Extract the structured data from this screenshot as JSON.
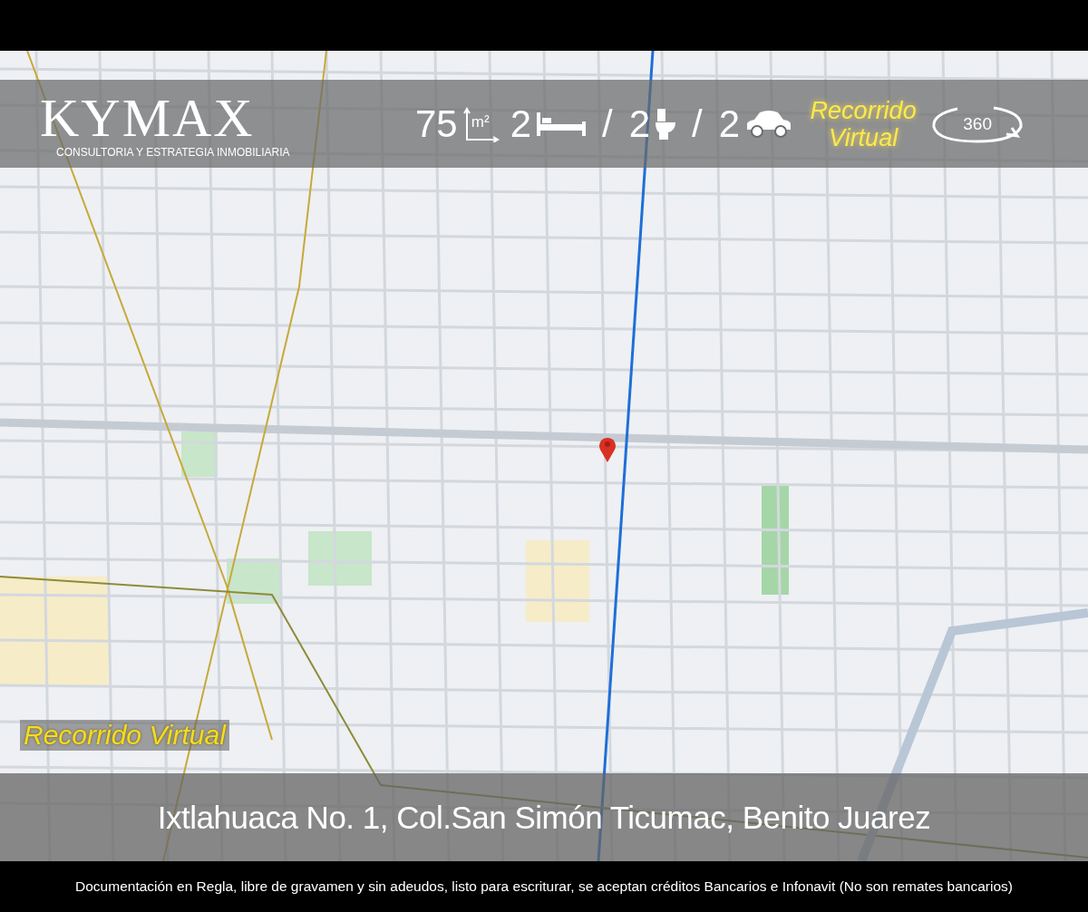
{
  "brand": {
    "name": "KYMAX",
    "tagline": "CONSULTORIA Y ESTRATEGIA INMOBILIARIA"
  },
  "features": [
    {
      "kind": "area",
      "value": "75",
      "unit": "m²"
    },
    {
      "kind": "bed",
      "value": "2"
    },
    {
      "kind": "separator",
      "value": "/"
    },
    {
      "kind": "bath",
      "value": "2"
    },
    {
      "kind": "separator",
      "value": "/"
    },
    {
      "kind": "parking",
      "value": "2"
    }
  ],
  "virtual_tour": {
    "label": "Recorrido Virtual",
    "badge": "360"
  },
  "map_label": "Recorrido Virtual",
  "address": "Ixtlahuaca No. 1, Col.San Simón Ticumac, Benito Juarez",
  "footer": "Documentación en Regla, libre de gravamen y sin adeudos, listo para escriturar, se aceptan créditos Bancarios e Infonavit (No son remates bancarios)"
}
